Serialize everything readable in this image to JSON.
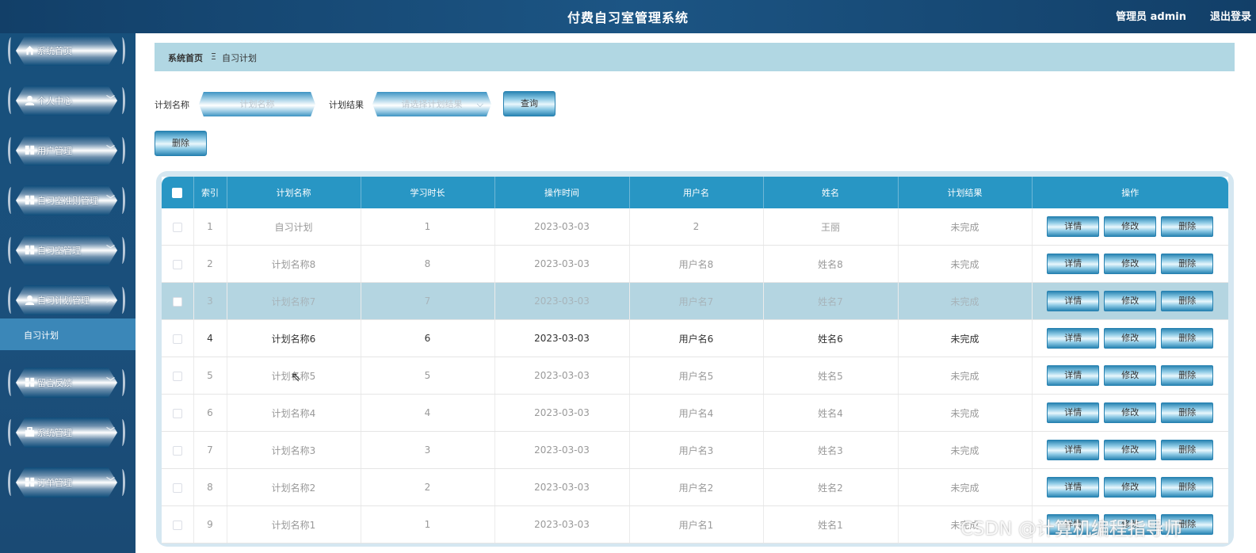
{
  "header": {
    "title": "付费自习室管理系统",
    "user": "管理员 admin",
    "logout": "退出登录"
  },
  "sidebar": {
    "items": [
      {
        "label": "系统首页",
        "icon": "home-icon"
      },
      {
        "label": "个人中心",
        "icon": "user-icon"
      },
      {
        "label": "用户管理",
        "icon": "grid-icon"
      },
      {
        "label": "自习室准则管理",
        "icon": "grid-icon"
      },
      {
        "label": "自习室管理",
        "icon": "grid-icon"
      },
      {
        "label": "自习计划管理",
        "icon": "user-icon"
      },
      {
        "label": "留言反馈",
        "icon": "grid-icon"
      },
      {
        "label": "系统管理",
        "icon": "briefcase-icon"
      },
      {
        "label": "订单管理",
        "icon": "grid-icon"
      }
    ],
    "active_sub": "自习计划"
  },
  "breadcrumb": {
    "home": "系统首页",
    "separator": "Ξ",
    "current": "自习计划"
  },
  "search": {
    "name_label": "计划名称",
    "name_placeholder": "计划名称",
    "result_label": "计划结果",
    "result_placeholder": "请选择计划结果",
    "query_button": "查询",
    "delete_button": "删除"
  },
  "table": {
    "columns": [
      "索引",
      "计划名称",
      "学习时长",
      "操作时间",
      "用户名",
      "姓名",
      "计划结果",
      "操作"
    ],
    "actions": [
      "详情",
      "修改",
      "删除"
    ],
    "rows": [
      [
        "1",
        "自习计划",
        "1",
        "2023-03-03",
        "2",
        "王丽",
        "未完成"
      ],
      [
        "2",
        "计划名称8",
        "8",
        "2023-03-03",
        "用户名8",
        "姓名8",
        "未完成"
      ],
      [
        "3",
        "计划名称7",
        "7",
        "2023-03-03",
        "用户名7",
        "姓名7",
        "未完成"
      ],
      [
        "4",
        "计划名称6",
        "6",
        "2023-03-03",
        "用户名6",
        "姓名6",
        "未完成"
      ],
      [
        "5",
        "计划名称5",
        "5",
        "2023-03-03",
        "用户名5",
        "姓名5",
        "未完成"
      ],
      [
        "6",
        "计划名称4",
        "4",
        "2023-03-03",
        "用户名4",
        "姓名4",
        "未完成"
      ],
      [
        "7",
        "计划名称3",
        "3",
        "2023-03-03",
        "用户名3",
        "姓名3",
        "未完成"
      ],
      [
        "8",
        "计划名称2",
        "2",
        "2023-03-03",
        "用户名2",
        "姓名2",
        "未完成"
      ],
      [
        "9",
        "计划名称1",
        "1",
        "2023-03-03",
        "用户名1",
        "姓名1",
        "未完成"
      ]
    ],
    "highlighted_row": 3,
    "bold_row": 4
  },
  "watermark": "CSDN @计算机编程指导师",
  "colors": {
    "header_bg": "#1c5584",
    "sidebar_bg": "#17507c",
    "table_header": "#2896c4",
    "breadcrumb_bg": "#b1d7e3",
    "active_sub_bg": "#3b87b8"
  }
}
